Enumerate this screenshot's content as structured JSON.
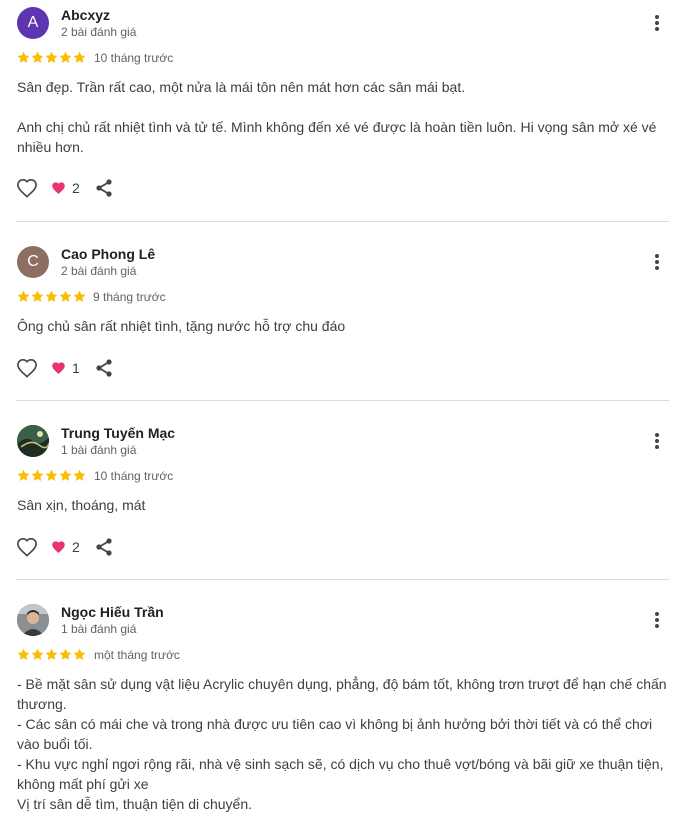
{
  "colors": {
    "star": "#fbbc04",
    "heart": "#e8336e",
    "divider": "#dadce0"
  },
  "reviews": [
    {
      "avatar_letter": "A",
      "avatar_color": "#5e35b1",
      "name": "Abcxyz",
      "review_count": "2 bài đánh giá",
      "rating": 5,
      "time": "10 tháng trước",
      "text": "Sân đẹp. Trần rất cao, một nửa là mái tôn nên mát hơn các sân mái bạt.\n\nAnh chị chủ rất nhiệt tình và tử tế. Mình không đến xé vé được là hoàn tiền luôn. Hi vọng sân mở xé vé nhiều hơn.",
      "reactions": "2"
    },
    {
      "avatar_letter": "C",
      "avatar_color": "#8d6e63",
      "name": "Cao Phong Lê",
      "review_count": "2 bài đánh giá",
      "rating": 5,
      "time": "9 tháng trước",
      "text": "Ông chủ sân rất nhiệt tình, tặng nước hỗ trợ chu đáo",
      "reactions": "1"
    },
    {
      "avatar_letter": "",
      "avatar_color": "#2e4a3a",
      "name": "Trung Tuyến Mạc",
      "review_count": "1 bài đánh giá",
      "rating": 5,
      "time": "10 tháng trước",
      "text": "Sân xịn, thoáng, mát",
      "reactions": "2"
    },
    {
      "avatar_letter": "",
      "avatar_color": "#6d6d6d",
      "name": "Ngọc Hiếu Trần",
      "review_count": "1 bài đánh giá",
      "rating": 5,
      "time": "một tháng trước",
      "text": "- Bề mặt sân sử dụng vật liệu Acrylic chuyên dụng, phẳng, độ bám tốt, không trơn trượt để hạn chế chấn thương.\n- Các sân có mái che và trong nhà được ưu tiên cao vì không bị ảnh hưởng bởi thời tiết và có thể chơi vào buổi tối.\n- Khu vực nghỉ ngơi rộng rãi, nhà vệ sinh sạch sẽ, có dịch vụ cho thuê vợt/bóng và bãi giữ xe thuận tiện, không mất phí gửi xe\nVị trí sân dễ tìm, thuận tiện di chuyển.",
      "reactions": ""
    }
  ]
}
